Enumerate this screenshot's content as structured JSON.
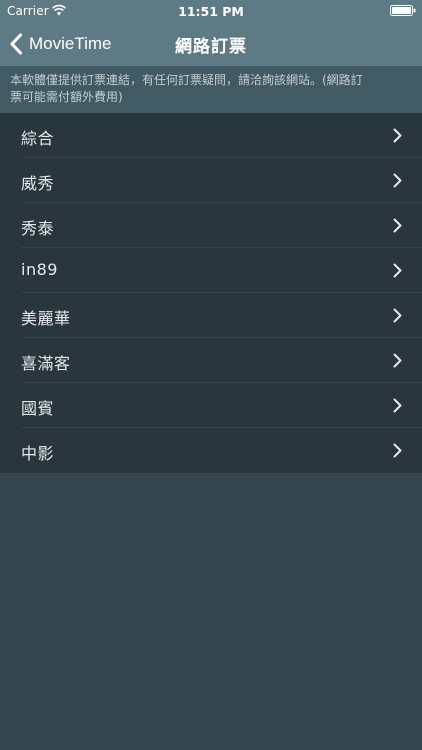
{
  "status_bar": {
    "carrier": "Carrier",
    "time": "11:51 PM",
    "wifi_icon": "wifi-icon",
    "battery_icon": "battery-full-icon"
  },
  "nav": {
    "back_label": "MovieTime",
    "back_icon": "chevron-left-icon",
    "title": "網路訂票"
  },
  "notice": {
    "line1": "本軟體僅提供訂票連結，有任何訂票疑問，請洽詢該網站。(網路訂",
    "line2": "票可能需付額外費用)"
  },
  "list": {
    "items": [
      {
        "label": "綜合"
      },
      {
        "label": "威秀"
      },
      {
        "label": "秀泰"
      },
      {
        "label": "in89"
      },
      {
        "label": "美麗華"
      },
      {
        "label": "喜滿客"
      },
      {
        "label": "國賓"
      },
      {
        "label": "中影"
      }
    ],
    "chevron_icon": "chevron-right-icon"
  },
  "colors": {
    "nav_background": "#5e7a85",
    "notice_background": "#425a64",
    "list_background": "#29363d",
    "page_background": "#37474f",
    "text": "#e6eaec"
  }
}
